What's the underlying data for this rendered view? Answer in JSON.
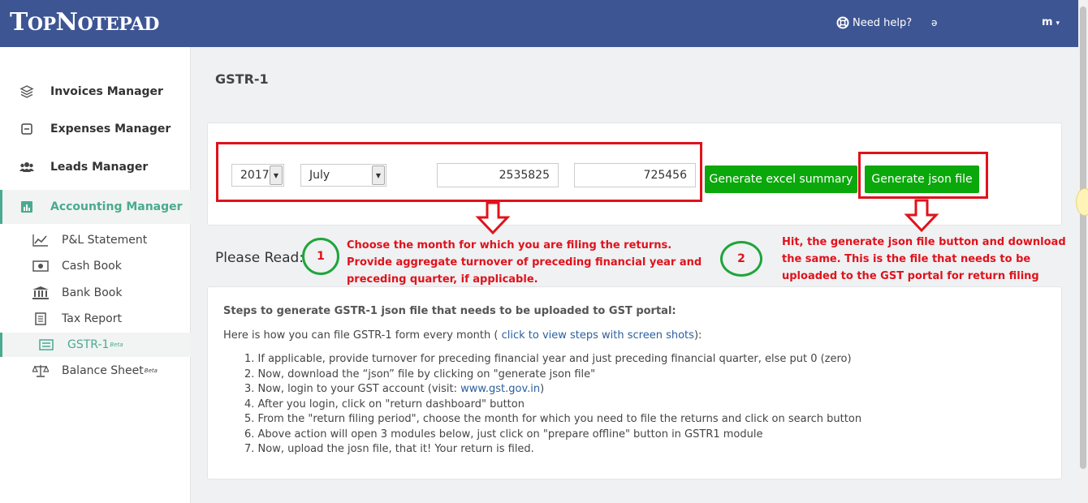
{
  "header": {
    "logo_big_1": "T",
    "logo_small_1": "OP",
    "logo_big_2": "N",
    "logo_small_2": "OTEPAD",
    "help_label": "Need help?",
    "tiny_char": "ǝ",
    "user_label": "m",
    "user_caret": "▾"
  },
  "sidebar": {
    "items": [
      {
        "label": "Invoices Manager",
        "icon": "layers-icon"
      },
      {
        "label": "Expenses Manager",
        "icon": "minus-square-icon"
      },
      {
        "label": "Leads Manager",
        "icon": "users-icon"
      },
      {
        "label": "Accounting Manager",
        "icon": "bar-chart-icon"
      }
    ],
    "sub_items": [
      {
        "label": "P&L Statement",
        "icon": "line-chart-icon"
      },
      {
        "label": "Cash Book",
        "icon": "money-icon"
      },
      {
        "label": "Bank Book",
        "icon": "bank-icon"
      },
      {
        "label": "Tax Report",
        "icon": "document-icon"
      },
      {
        "label": "GSTR-1",
        "beta": "Beta",
        "icon": "list-icon"
      },
      {
        "label": "Balance Sheet",
        "beta": "Beta",
        "icon": "balance-scale-icon"
      }
    ],
    "active_color": "#4aaa8f"
  },
  "main": {
    "page_title": "GSTR-1",
    "form": {
      "year": "2017",
      "month": "July",
      "turnover_prev_year": "2535825",
      "turnover_prev_quarter": "725456",
      "excel_button": "Generate excel summary",
      "json_button": "Generate json file"
    },
    "please_read": "Please Read:",
    "annotation_1": {
      "number": "1",
      "lines": [
        "Choose the month for which you are filing the returns.",
        "Provide aggregate turnover of preceding financial year and",
        "preceding quarter, if applicable."
      ]
    },
    "annotation_2": {
      "number": "2",
      "lines": [
        "Hit, the generate json file button and download",
        "the same. This is the file that needs to be",
        "uploaded to the GST portal for return filing"
      ]
    },
    "steps_heading": "Steps to generate GSTR-1 json file that needs to be uploaded to GST portal:",
    "intro_text": "Here is how you can file GSTR-1 form every month ( ",
    "intro_link": "click to view steps with screen shots",
    "intro_end": "):",
    "steps": [
      "1. If applicable, provide turnover for preceding financial year and just preceding financial quarter, else put 0 (zero)",
      "2. Now, download the “json” file by clicking on \"generate json file\"",
      "3. Now, login to your GST account (visit: ",
      "4. After you login, click on \"return dashboard\" button",
      "5. From the \"return filing period\", choose the month for which you need to file the returns and click on search button",
      "6. Above action will open 3 modules below, just click on \"prepare offline\" button in GSTR1 module",
      "7. Now, upload the josn file, that it! Your return is filed."
    ],
    "step3_link": "www.gst.gov.in",
    "step3_end": ")"
  },
  "colors": {
    "header": "#3e5593",
    "button_green": "#0aa80a",
    "annotation_red": "#e0121b",
    "circle_green": "#1fa53a"
  }
}
